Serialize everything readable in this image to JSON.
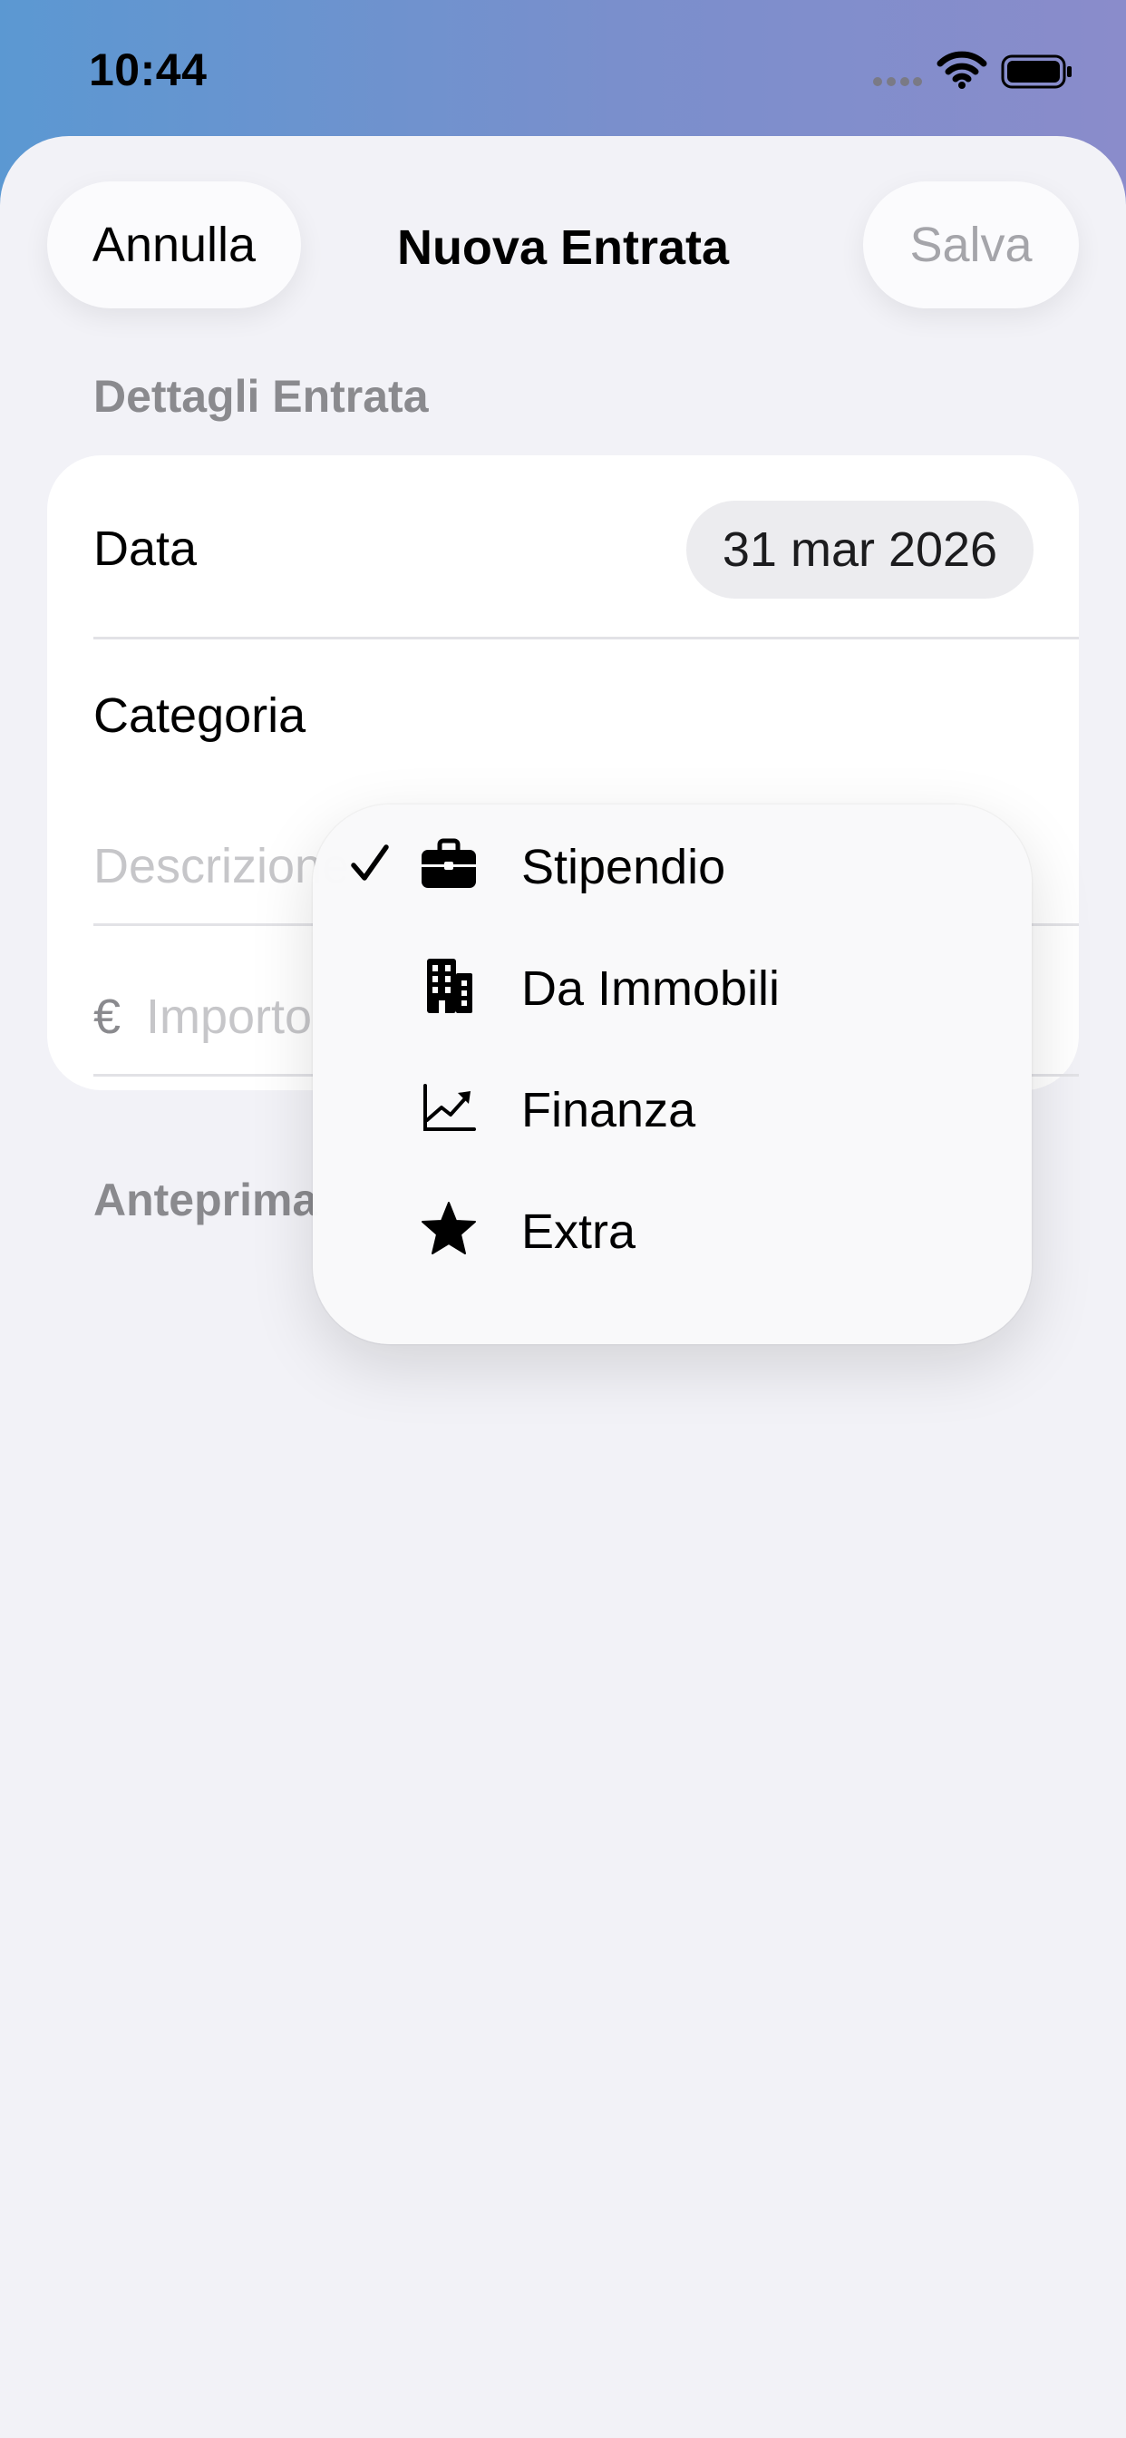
{
  "status_bar": {
    "time": "10:44",
    "icons": [
      "cellular-signal-icon",
      "wifi-icon",
      "battery-icon"
    ]
  },
  "nav": {
    "cancel_label": "Annulla",
    "title": "Nuova Entrata",
    "save_label": "Salva"
  },
  "form": {
    "section_title": "Dettagli Entrata",
    "date_label": "Data",
    "date_value": "31 mar 2026",
    "category_label": "Categoria",
    "description_placeholder": "Descrizione",
    "currency_symbol": "€",
    "amount_placeholder": "Importo"
  },
  "category_menu": {
    "items": [
      {
        "label": "Stipendio",
        "icon": "briefcase-icon",
        "selected": true
      },
      {
        "label": "Da Immobili",
        "icon": "building-icon",
        "selected": false
      },
      {
        "label": "Finanza",
        "icon": "chart-line-uptrend-icon",
        "selected": false
      },
      {
        "label": "Extra",
        "icon": "star-icon",
        "selected": false
      }
    ]
  },
  "preview": {
    "section_title": "Anteprima"
  },
  "colors": {
    "background": "#f2f2f7",
    "header_gradient_start": "#5b98d2",
    "header_gradient_end": "#8a8ccb",
    "secondary_text": "#8a8a8e",
    "placeholder_text": "#c6c6c9",
    "disabled_button_text": "#a5a5aa"
  }
}
